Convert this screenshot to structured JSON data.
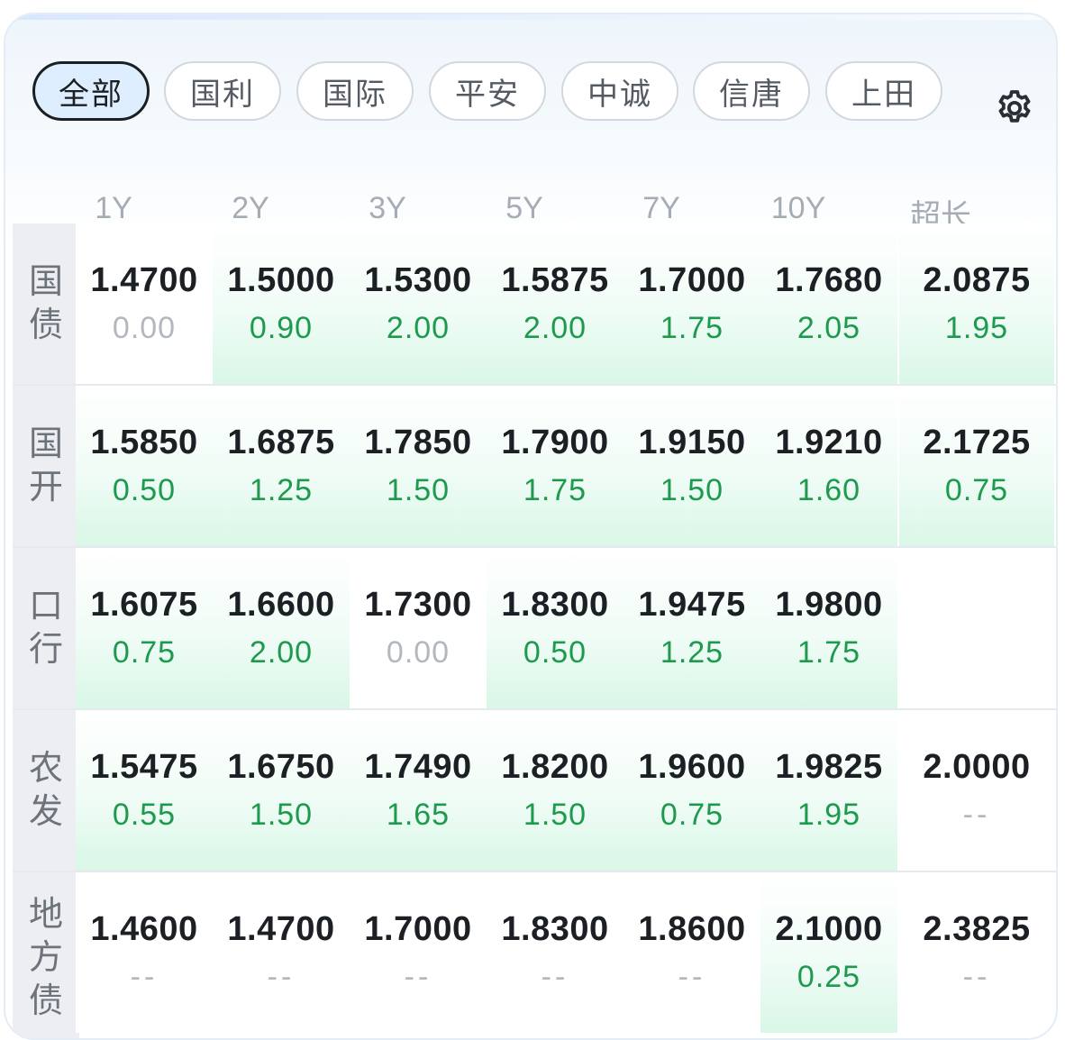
{
  "filters": [
    {
      "label": "全部",
      "active": true
    },
    {
      "label": "国利",
      "active": false
    },
    {
      "label": "国际",
      "active": false
    },
    {
      "label": "平安",
      "active": false
    },
    {
      "label": "中诚",
      "active": false
    },
    {
      "label": "信唐",
      "active": false
    },
    {
      "label": "上田",
      "active": false
    }
  ],
  "settings_icon": "gear-icon",
  "columns": [
    "1Y",
    "2Y",
    "3Y",
    "5Y",
    "7Y",
    "10Y",
    "超长"
  ],
  "rows": [
    {
      "name": "国债",
      "cells": [
        {
          "rate": "1.4700",
          "chg": "0.00",
          "tone": "zero"
        },
        {
          "rate": "1.5000",
          "chg": "0.90",
          "tone": "pos"
        },
        {
          "rate": "1.5300",
          "chg": "2.00",
          "tone": "pos"
        },
        {
          "rate": "1.5875",
          "chg": "2.00",
          "tone": "pos"
        },
        {
          "rate": "1.7000",
          "chg": "1.75",
          "tone": "pos"
        },
        {
          "rate": "1.7680",
          "chg": "2.05",
          "tone": "pos"
        },
        {
          "rate": "2.0875",
          "chg": "1.95",
          "tone": "pos"
        }
      ]
    },
    {
      "name": "国开",
      "cells": [
        {
          "rate": "1.5850",
          "chg": "0.50",
          "tone": "pos"
        },
        {
          "rate": "1.6875",
          "chg": "1.25",
          "tone": "pos"
        },
        {
          "rate": "1.7850",
          "chg": "1.50",
          "tone": "pos"
        },
        {
          "rate": "1.7900",
          "chg": "1.75",
          "tone": "pos"
        },
        {
          "rate": "1.9150",
          "chg": "1.50",
          "tone": "pos"
        },
        {
          "rate": "1.9210",
          "chg": "1.60",
          "tone": "pos"
        },
        {
          "rate": "2.1725",
          "chg": "0.75",
          "tone": "pos"
        }
      ]
    },
    {
      "name": "口行",
      "cells": [
        {
          "rate": "1.6075",
          "chg": "0.75",
          "tone": "pos"
        },
        {
          "rate": "1.6600",
          "chg": "2.00",
          "tone": "pos"
        },
        {
          "rate": "1.7300",
          "chg": "0.00",
          "tone": "zero"
        },
        {
          "rate": "1.8300",
          "chg": "0.50",
          "tone": "pos"
        },
        {
          "rate": "1.9475",
          "chg": "1.25",
          "tone": "pos"
        },
        {
          "rate": "1.9800",
          "chg": "1.75",
          "tone": "pos"
        },
        {
          "rate": "",
          "chg": "",
          "tone": "empty"
        }
      ]
    },
    {
      "name": "农发",
      "cells": [
        {
          "rate": "1.5475",
          "chg": "0.55",
          "tone": "pos"
        },
        {
          "rate": "1.6750",
          "chg": "1.50",
          "tone": "pos"
        },
        {
          "rate": "1.7490",
          "chg": "1.65",
          "tone": "pos"
        },
        {
          "rate": "1.8200",
          "chg": "1.50",
          "tone": "pos"
        },
        {
          "rate": "1.9600",
          "chg": "0.75",
          "tone": "pos"
        },
        {
          "rate": "1.9825",
          "chg": "1.95",
          "tone": "pos"
        },
        {
          "rate": "2.0000",
          "chg": "--",
          "tone": "dash"
        }
      ]
    },
    {
      "name": "地方债",
      "cells": [
        {
          "rate": "1.4600",
          "chg": "--",
          "tone": "dash"
        },
        {
          "rate": "1.4700",
          "chg": "--",
          "tone": "dash"
        },
        {
          "rate": "1.7000",
          "chg": "--",
          "tone": "dash"
        },
        {
          "rate": "1.8300",
          "chg": "--",
          "tone": "dash"
        },
        {
          "rate": "1.8600",
          "chg": "--",
          "tone": "dash"
        },
        {
          "rate": "2.1000",
          "chg": "0.25",
          "tone": "pos"
        },
        {
          "rate": "2.3825",
          "chg": "--",
          "tone": "dash"
        }
      ]
    }
  ]
}
